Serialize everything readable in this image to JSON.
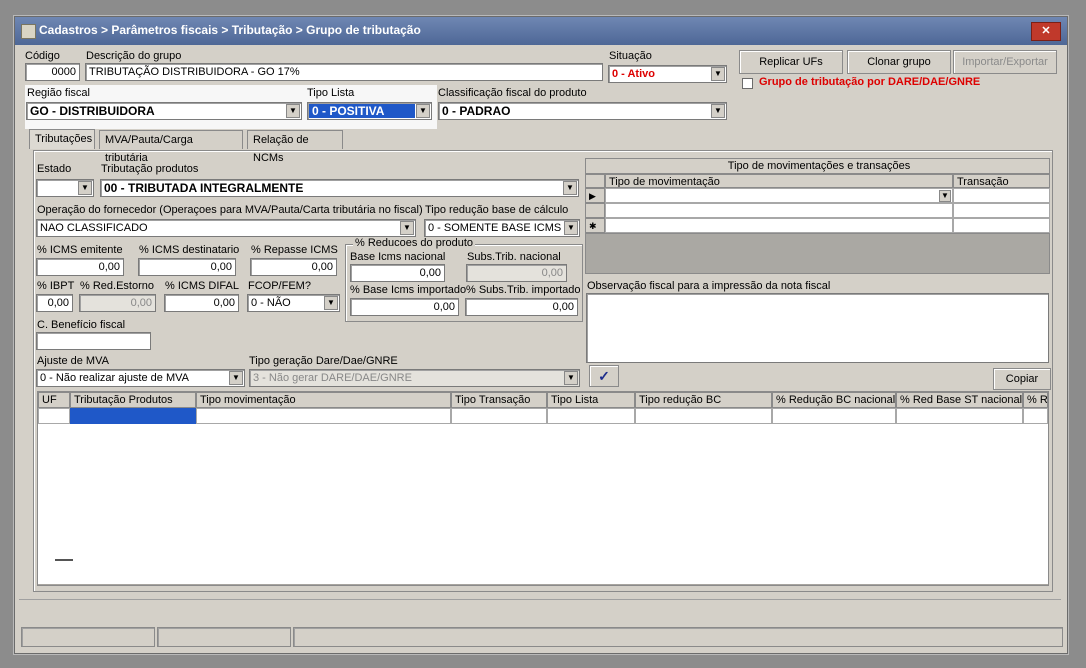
{
  "window": {
    "title": "Cadastros > Parâmetros fiscais > Tributação > Grupo de tributação",
    "close_label": "✕"
  },
  "header": {
    "codigo_label": "Código",
    "codigo_value": "0000",
    "descricao_label": "Descrição do grupo",
    "descricao_value": "TRIBUTAÇÃO DISTRIBUIDORA - GO 17%",
    "situacao_label": "Situação",
    "situacao_value": "0 - Ativo",
    "regiao_label": "Região fiscal",
    "regiao_value": "GO - DISTRIBUIDORA",
    "tipo_lista_label": "Tipo Lista",
    "tipo_lista_value": "0 - POSITIVA",
    "classificacao_label": "Classificação fiscal do produto",
    "classificacao_value": "0 - PADRAO",
    "replicar_label": "Replicar UFs",
    "clonar_label": "Clonar grupo",
    "importar_label": "Importar/Exportar",
    "dare_checkbox_label": "Grupo de tributação por DARE/DAE/GNRE"
  },
  "tabs": [
    {
      "label": "Tributações"
    },
    {
      "label": "MVA/Pauta/Carga tributária"
    },
    {
      "label": "Relação de NCMs"
    }
  ],
  "form": {
    "estado_label": "Estado",
    "tributacao_label": "Tributação produtos",
    "tributacao_value": "00 - TRIBUTADA INTEGRALMENTE",
    "operacao_label": "Operação do fornecedor (Operaçoes para MVA/Pauta/Carta tributária no fiscal)",
    "operacao_value": "NAO CLASSIFICADO",
    "tipo_reducao_label": "Tipo redução base de cálculo",
    "tipo_reducao_value": "0 - SOMENTE BASE ICMS",
    "icms_emitente_label": "% ICMS emitente",
    "icms_emitente_value": "0,00",
    "icms_dest_label": "% ICMS destinatario",
    "icms_dest_value": "0,00",
    "repasse_label": "% Repasse ICMS",
    "repasse_value": "0,00",
    "reducoes_group_label": "% Reducoes do produto",
    "base_icms_nac_label": "Base Icms nacional",
    "base_icms_nac_value": "0,00",
    "subs_trib_nac_label": "Subs.Trib. nacional",
    "subs_trib_nac_value": "0,00",
    "base_icms_imp_label": "% Base Icms importado",
    "base_icms_imp_value": "0,00",
    "subs_trib_imp_label": "% Subs.Trib. importado",
    "subs_trib_imp_value": "0,00",
    "ibpt_label": "% IBPT",
    "ibpt_value": "0,00",
    "red_estorno_label": "% Red.Estorno",
    "red_estorno_value": "0,00",
    "icms_difal_label": "% ICMS DIFAL",
    "icms_difal_value": "0,00",
    "fcop_label": "FCOP/FEM?",
    "fcop_value": "0 - NÃO",
    "beneficio_label": "C. Benefício fiscal",
    "ajuste_mva_label": "Ajuste de MVA",
    "ajuste_mva_value": "0 - Não realizar ajuste de MVA",
    "tipo_geracao_label": "Tipo geração Dare/Dae/GNRE",
    "tipo_geracao_value": "3 - Não gerar DARE/DAE/GNRE",
    "confirm_label": "✓",
    "copiar_label": "Copiar"
  },
  "movimentacoes": {
    "title": "Tipo de movimentações e transações",
    "columns": [
      "Tipo de movimentação",
      "Transação"
    ],
    "row_indicators": [
      "▶",
      "",
      "✱"
    ]
  },
  "observacao_label": "Observação fiscal para a impressão da nota fiscal",
  "grid": {
    "columns": [
      "UF",
      "Tributação Produtos",
      "Tipo movimentação",
      "Tipo Transação",
      "Tipo Lista",
      "Tipo redução BC",
      "% Redução BC nacional",
      "% Red Base ST nacional",
      "% Re"
    ]
  },
  "colors": {
    "title_bar": "#5a74a4",
    "red_text": "#d00000",
    "highlight_selection": "#1f58c8"
  }
}
